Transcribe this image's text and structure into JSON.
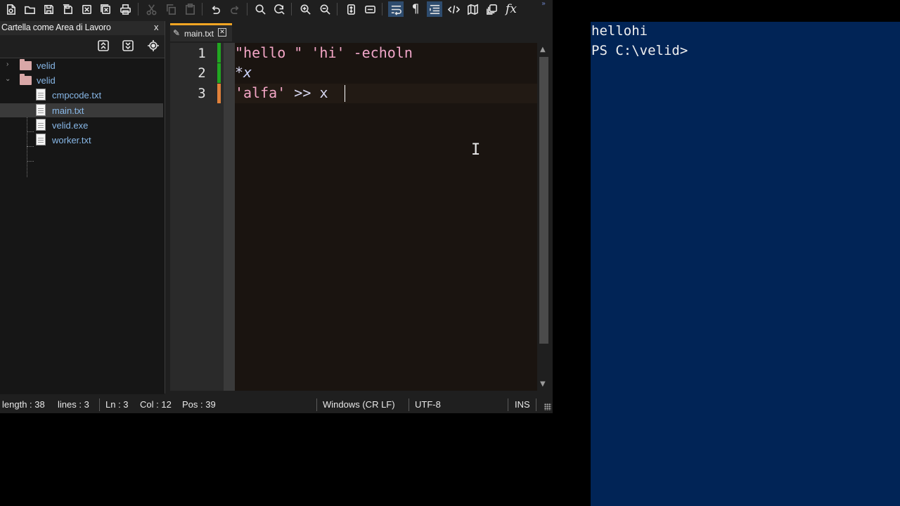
{
  "toolbar": {
    "icons": [
      "new-file-icon",
      "open-folder-icon",
      "save-icon",
      "save-all-icon",
      "close-icon",
      "close-all-icon",
      "print-icon",
      "cut-icon",
      "copy-icon",
      "paste-icon",
      "undo-icon",
      "redo-icon",
      "find-icon",
      "replace-icon",
      "zoom-in-icon",
      "zoom-out-icon",
      "sync-scroll-icon",
      "word-wrap-icon",
      "wrap-text-icon",
      "show-symbols-icon",
      "indent-guide-icon",
      "code-icon",
      "map-icon",
      "macro-icon",
      "function-icon"
    ],
    "function_label": "fx",
    "active_color": "#2e4c6e"
  },
  "panel": {
    "title": "Cartella come Area di Lavoro",
    "close_label": "x",
    "tree": [
      {
        "label": "velid",
        "type": "folder",
        "expanded": false
      },
      {
        "label": "velid",
        "type": "folder",
        "expanded": true
      },
      {
        "label": "cmpcode.txt",
        "type": "file"
      },
      {
        "label": "main.txt",
        "type": "file",
        "selected": true
      },
      {
        "label": "velid.exe",
        "type": "file"
      },
      {
        "label": "worker.txt",
        "type": "file"
      }
    ]
  },
  "tab": {
    "label": "main.txt",
    "accent": "#f5a623"
  },
  "editor": {
    "line_numbers": [
      "1",
      "2",
      "3"
    ],
    "lines": [
      {
        "tokens": [
          {
            "t": "\"hello \"",
            "c": "str"
          },
          {
            "t": " ",
            "c": ""
          },
          {
            "t": "'hi'",
            "c": "str"
          },
          {
            "t": " ",
            "c": ""
          },
          {
            "t": "-echoln",
            "c": "kw"
          }
        ]
      },
      {
        "tokens": [
          {
            "t": "*",
            "c": "op"
          },
          {
            "t": "x",
            "c": "var"
          }
        ]
      },
      {
        "tokens": [
          {
            "t": "'alfa'",
            "c": "str"
          },
          {
            "t": " ",
            "c": ""
          },
          {
            "t": ">>",
            "c": "op"
          },
          {
            "t": " ",
            "c": ""
          },
          {
            "t": "x",
            "c": "op"
          }
        ]
      }
    ],
    "change_markers": [
      "#21a621",
      "#21a621",
      "#e0813a"
    ]
  },
  "status": {
    "length": "length : 38",
    "lines": "lines : 3",
    "ln": "Ln : 3",
    "col": "Col : 12",
    "pos": "Pos : 39",
    "eol": "Windows (CR LF)",
    "encoding": "UTF-8",
    "mode": "INS"
  },
  "console": {
    "lines": [
      "hellohi",
      "PS C:\\velid>"
    ],
    "background": "#012456"
  }
}
